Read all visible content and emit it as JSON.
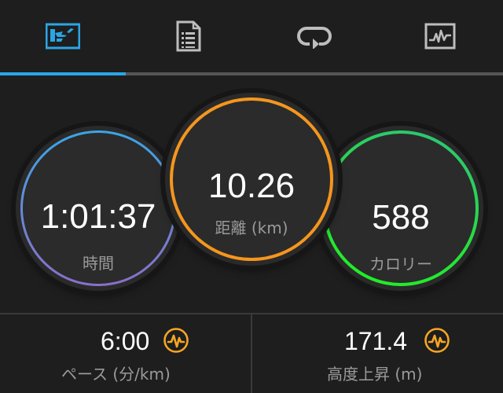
{
  "tabs": [
    {
      "icon": "activity-summary-icon",
      "active": true
    },
    {
      "icon": "details-list-icon",
      "active": false
    },
    {
      "icon": "laps-icon",
      "active": false
    },
    {
      "icon": "chart-graph-icon",
      "active": false
    }
  ],
  "stats": {
    "time": {
      "value": "1:01:37",
      "label": "時間"
    },
    "distance": {
      "value": "10.26",
      "label": "距離 (km)"
    },
    "calories": {
      "value": "588",
      "label": "カロリー"
    }
  },
  "bottom": {
    "pace": {
      "value": "6:00",
      "label": "ペース (分/km)",
      "icon": "pulse-badge-icon"
    },
    "elevation": {
      "value": "171.4",
      "label": "高度上昇 (m)",
      "icon": "pulse-badge-icon"
    }
  },
  "colors": {
    "accent": "#2aa6e6",
    "distance_ring": "#f5961e",
    "calorie_ring": "#25e23a",
    "time_ring_top": "#3aa5e6",
    "time_ring_bottom": "#8a6fc8",
    "badge": "#f5a623"
  }
}
